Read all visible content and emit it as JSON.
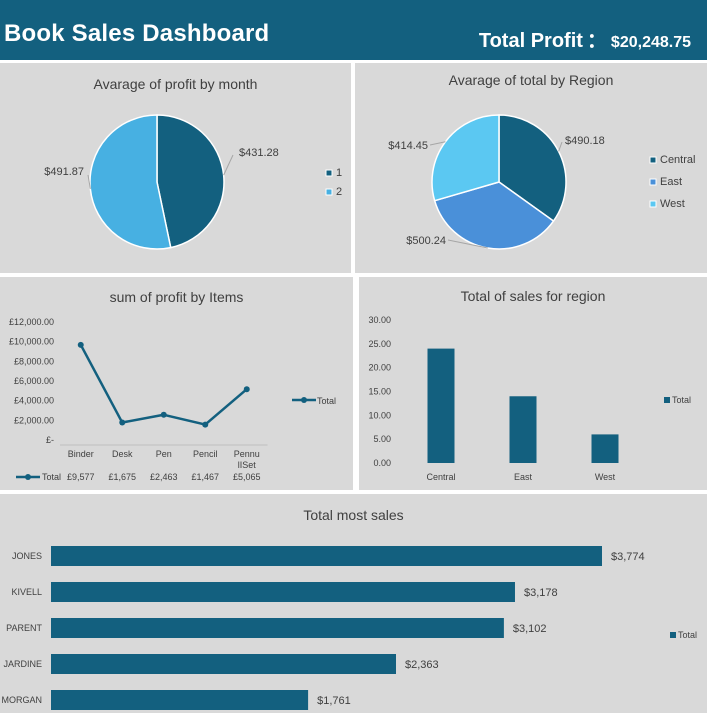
{
  "header": {
    "title": "Book Sales Dashboard",
    "total_profit_label": "Total Profit",
    "total_profit_colon": "：",
    "total_profit_value": "$20,248.75"
  },
  "colors": {
    "header_bg": "#13607f",
    "dark_blue": "#13607f",
    "mid_blue": "#4a90d9",
    "light_blue": "#5bc8f2",
    "panel_bg": "#d9d9d9"
  },
  "chart_data": [
    {
      "type": "pie",
      "title": "Avarage of profit by month",
      "labels": [
        "1",
        "2"
      ],
      "values": [
        431.28,
        491.87
      ],
      "data_labels": [
        "$431.28",
        "$491.87"
      ],
      "colors": [
        "#13607f",
        "#47b0e2"
      ],
      "legend": "right"
    },
    {
      "type": "pie",
      "title": "Avarage of total by Region",
      "labels": [
        "Central",
        "East",
        "West"
      ],
      "values": [
        490.18,
        500.24,
        414.45
      ],
      "data_labels": [
        "$490.18",
        "$500.24",
        "$414.45"
      ],
      "colors": [
        "#13607f",
        "#4a90d9",
        "#5bc8f2"
      ],
      "legend": "right"
    },
    {
      "type": "line",
      "title": "sum of profit by Items",
      "categories": [
        "Binder",
        "Desk",
        "Pen",
        "Pencil",
        "PennulISet"
      ],
      "category_lines": [
        [
          "Binder"
        ],
        [
          "Desk"
        ],
        [
          "Pen"
        ],
        [
          "Pencil"
        ],
        [
          "Pennu",
          "lISet"
        ]
      ],
      "series": [
        {
          "name": "Total",
          "values": [
            9577,
            1675,
            2463,
            1467,
            5065
          ]
        }
      ],
      "table_values": [
        "£9,577",
        "£1,675",
        "£2,463",
        "£1,467",
        "£5,065"
      ],
      "ylim": [
        0,
        12000
      ],
      "yticks": [
        0,
        2000,
        4000,
        6000,
        8000,
        10000,
        12000
      ],
      "ytick_labels": [
        "£-",
        "£2,000.00",
        "£4,000.00",
        "£6,000.00",
        "£8,000.00",
        "£10,000.00",
        "£12,000.00"
      ],
      "legend": "right",
      "legend_label": "Total",
      "data_table": true
    },
    {
      "type": "bar",
      "title": "Total of sales for region",
      "categories": [
        "Central",
        "East",
        "West"
      ],
      "series": [
        {
          "name": "Total",
          "values": [
            24,
            14,
            6
          ]
        }
      ],
      "ylim": [
        0,
        30
      ],
      "yticks": [
        0,
        5,
        10,
        15,
        20,
        25,
        30
      ],
      "ytick_labels": [
        "0.00",
        "5.00",
        "10.00",
        "15.00",
        "20.00",
        "25.00",
        "30.00"
      ],
      "legend": "right",
      "legend_label": "Total"
    },
    {
      "type": "bar",
      "orientation": "horizontal",
      "title": "Total most sales",
      "categories": [
        "JONES",
        "KIVELL",
        "PARENT",
        "JARDINE",
        "MORGAN"
      ],
      "series": [
        {
          "name": "Total",
          "values": [
            3774,
            3178,
            3102,
            2363,
            1761
          ]
        }
      ],
      "data_labels": [
        "$3,774",
        "$3,178",
        "$3,102",
        "$2,363",
        "$1,761"
      ],
      "legend": "right",
      "legend_label": "Total"
    }
  ]
}
